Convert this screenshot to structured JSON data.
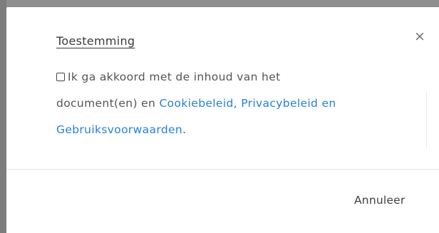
{
  "dialog": {
    "title": "Toestemming",
    "close_label": "×",
    "consent": {
      "checked": false,
      "text_line1": "Ik ga akkoord met de inhoud van het",
      "text_line2_prefix": "document(en) en ",
      "link_cookie": "Cookiebeleid",
      "comma": ", ",
      "link_privacy": "Privacybeleid en",
      "link_terms": "Gebruiksvoorwaarden",
      "period": "."
    },
    "cancel_label": "Annuleer"
  },
  "colors": {
    "link": "#2680d9",
    "backdrop": "#8a8a8a",
    "text": "#555555"
  },
  "icons": {
    "close": "close-icon",
    "checkbox": "checkbox-unchecked"
  }
}
